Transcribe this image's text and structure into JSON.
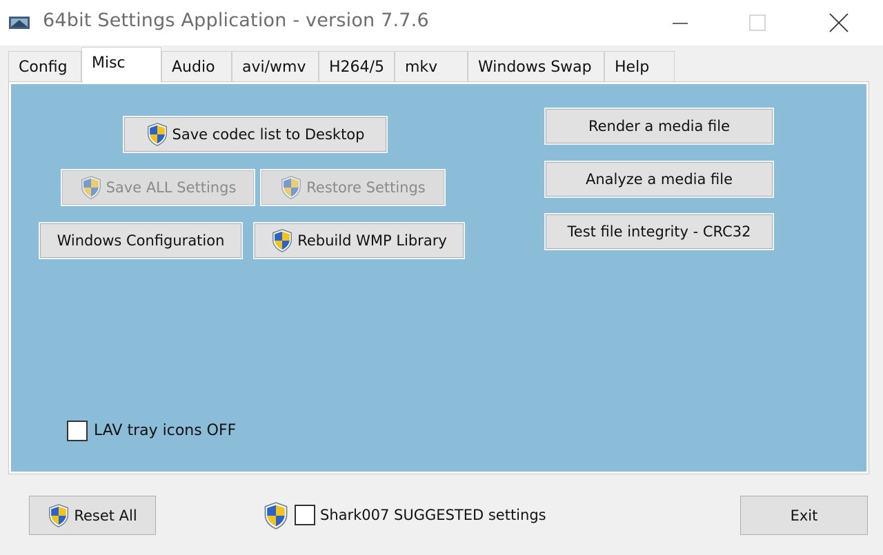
{
  "window": {
    "title": "64bit Settings Application - version 7.7.6",
    "icon": "app-icon"
  },
  "title_controls": {
    "minimize_icon": "minimize-icon",
    "maximize_icon": "maximize-icon",
    "close_icon": "close-icon"
  },
  "tabs": [
    {
      "label": "Config"
    },
    {
      "label": "Misc",
      "active": true
    },
    {
      "label": "Audio"
    },
    {
      "label": "avi/wmv"
    },
    {
      "label": "H264/5"
    },
    {
      "label": "mkv"
    },
    {
      "label": "Windows Swap"
    },
    {
      "label": "Help"
    }
  ],
  "misc": {
    "save_codec_list": "Save codec list to Desktop",
    "save_all_settings": "Save ALL Settings",
    "restore_settings": "Restore Settings",
    "windows_configuration": "Windows Configuration",
    "rebuild_wmp_library": "Rebuild WMP Library",
    "render_media_file": "Render a media file",
    "analyze_media_file": "Analyze a media file",
    "test_file_integrity": "Test file integrity - CRC32",
    "lav_tray_icons_off": "LAV tray icons OFF"
  },
  "footer": {
    "reset_all": "Reset All",
    "suggested_settings": "Shark007 SUGGESTED settings",
    "exit": "Exit"
  },
  "colors": {
    "panel_background": "#8bbdd8",
    "button_face": "#e1e1e1",
    "shield_blue": "#2a63c9",
    "shield_yellow": "#f3c21b"
  }
}
